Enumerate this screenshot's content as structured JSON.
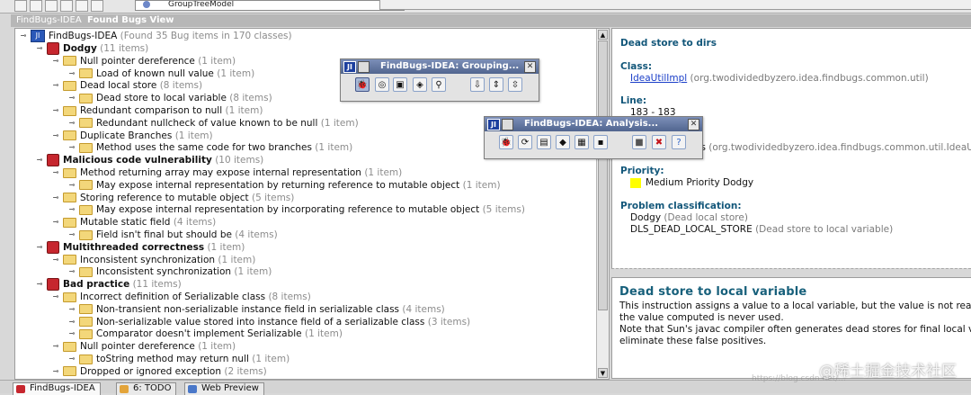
{
  "top": {
    "combo_value": "GroupTreeModel"
  },
  "window": {
    "title_app": "FindBugs-IDEA",
    "title_view": "Found Bugs View"
  },
  "tree": {
    "root": {
      "label": "FindBugs-IDEA",
      "count": "(Found 35 Bug items in 170 classes)"
    },
    "rows": [
      {
        "kind": "category",
        "label": "Dodgy",
        "count": "(11 items)"
      },
      {
        "kind": "type",
        "label": "Null pointer dereference",
        "count": "(1 item)"
      },
      {
        "kind": "pattern",
        "label": "Load of known null value",
        "count": "(1 item)"
      },
      {
        "kind": "type",
        "label": "Dead local store",
        "count": "(8 items)"
      },
      {
        "kind": "pattern",
        "label": "Dead store to local variable",
        "count": "(8 items)"
      },
      {
        "kind": "type",
        "label": "Redundant comparison to null",
        "count": "(1 item)"
      },
      {
        "kind": "pattern",
        "label": "Redundant nullcheck of value known to be null",
        "count": "(1 item)"
      },
      {
        "kind": "type",
        "label": "Duplicate Branches",
        "count": "(1 item)"
      },
      {
        "kind": "pattern",
        "label": "Method uses the same code for two branches",
        "count": "(1 item)"
      },
      {
        "kind": "category",
        "label": "Malicious code vulnerability",
        "count": "(10 items)"
      },
      {
        "kind": "type",
        "label": "Method returning array may expose internal representation",
        "count": "(1 item)"
      },
      {
        "kind": "pattern",
        "label": "May expose internal representation by returning reference to mutable object",
        "count": "(1 item)"
      },
      {
        "kind": "type",
        "label": "Storing reference to mutable object",
        "count": "(5 items)"
      },
      {
        "kind": "pattern",
        "label": "May expose internal representation by incorporating reference to mutable object",
        "count": "(5 items)"
      },
      {
        "kind": "type",
        "label": "Mutable static field",
        "count": "(4 items)"
      },
      {
        "kind": "pattern",
        "label": "Field isn't final but should be",
        "count": "(4 items)"
      },
      {
        "kind": "category",
        "label": "Multithreaded correctness",
        "count": "(1 item)"
      },
      {
        "kind": "type",
        "label": "Inconsistent synchronization",
        "count": "(1 item)"
      },
      {
        "kind": "pattern",
        "label": "Inconsistent synchronization",
        "count": "(1 item)"
      },
      {
        "kind": "category",
        "label": "Bad practice",
        "count": "(11 items)"
      },
      {
        "kind": "type",
        "label": "Incorrect definition of Serializable class",
        "count": "(8 items)"
      },
      {
        "kind": "pattern",
        "label": "Non-transient non-serializable instance field in serializable class",
        "count": "(4 items)"
      },
      {
        "kind": "pattern",
        "label": "Non-serializable value stored into instance field of a serializable class",
        "count": "(3 items)"
      },
      {
        "kind": "pattern",
        "label": "Comparator doesn't implement Serializable",
        "count": "(1 item)"
      },
      {
        "kind": "type",
        "label": "Null pointer dereference",
        "count": "(1 item)"
      },
      {
        "kind": "pattern",
        "label": "toString method may return null",
        "count": "(1 item)"
      },
      {
        "kind": "type",
        "label": "Dropped or ignored exception",
        "count": "(2 items)"
      }
    ]
  },
  "details": {
    "heading": "Dead store to dirs",
    "class_label": "Class:",
    "class_link": "IdeaUtilImpl",
    "class_pkg": "(org.twodividedbyzero.idea.findbugs.common.util)",
    "line_label": "Line:",
    "line_value": "183 - 183",
    "method_partial": "es",
    "method_pkg": "(org.twodividedbyzero.idea.findbugs.common.util.IdeaUti",
    "priority_label": "Priority:",
    "priority_value": "Medium Priority Dodgy",
    "priority_color": "#ffff00",
    "classification_label": "Problem classification:",
    "classification_1": "Dodgy",
    "classification_1_sub": "(Dead local store)",
    "classification_2": "DLS_DEAD_LOCAL_STORE",
    "classification_2_sub": "(Dead store to local variable)"
  },
  "description": {
    "title": "Dead store to local variable",
    "lines": [
      "This instruction assigns a value to a local variable, but the value is not read or",
      "the value computed is never used.",
      "Note that Sun's javac compiler often generates dead stores for final local varial",
      "eliminate these false positives."
    ]
  },
  "grouping_toolbar": {
    "title": "FindBugs-IDEA: Grouping..."
  },
  "analysis_toolbar": {
    "title": "FindBugs-IDEA: Analysis..."
  },
  "bottom_tabs": [
    {
      "label": "FindBugs-IDEA",
      "icon": "bug-icon"
    },
    {
      "label": "6: TODO",
      "icon": "todo-icon"
    },
    {
      "label": "Web Preview",
      "icon": "web-preview-icon"
    }
  ],
  "watermark": "@稀土掘金技术社区",
  "watermark_sub": "https://blog.csdn.net/..."
}
